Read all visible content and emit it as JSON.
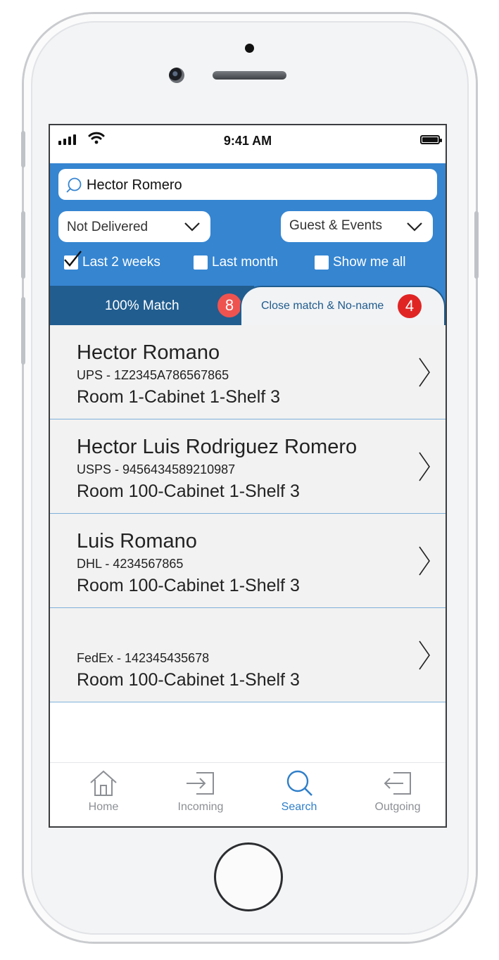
{
  "status_bar": {
    "time": "9:41 AM"
  },
  "search": {
    "value": "Hector Romero"
  },
  "filters": {
    "status_dropdown": "Not Delivered",
    "category_dropdown": "Guest & Events",
    "options": [
      {
        "label": "Last 2 weeks",
        "checked": true
      },
      {
        "label": "Last month",
        "checked": false
      },
      {
        "label": "Show me all",
        "checked": false
      }
    ]
  },
  "tabs": {
    "active": {
      "label": "100% Match",
      "count": "8"
    },
    "inactive": {
      "label": "Close match & No-name",
      "count": "4"
    }
  },
  "results": [
    {
      "name": "Hector Romano",
      "tracking": "UPS - 1Z2345A786567865",
      "location": "Room 1-Cabinet 1-Shelf 3"
    },
    {
      "name": "Hector Luis Rodriguez Romero",
      "tracking": "USPS - 9456434589210987",
      "location": "Room 100-Cabinet 1-Shelf 3"
    },
    {
      "name": "Luis Romano",
      "tracking": "DHL - 4234567865",
      "location": "Room 100-Cabinet 1-Shelf 3"
    },
    {
      "name": "",
      "tracking": "FedEx - 142345435678",
      "location": "Room 100-Cabinet 1-Shelf 3"
    }
  ],
  "nav": {
    "home": "Home",
    "incoming": "Incoming",
    "search": "Search",
    "outgoing": "Outgoing",
    "active": "search"
  },
  "colors": {
    "header_blue": "#3585d1",
    "tab_dark_blue": "#215d8f",
    "badge_red": "#e02424",
    "active_nav": "#2f7fc9"
  }
}
